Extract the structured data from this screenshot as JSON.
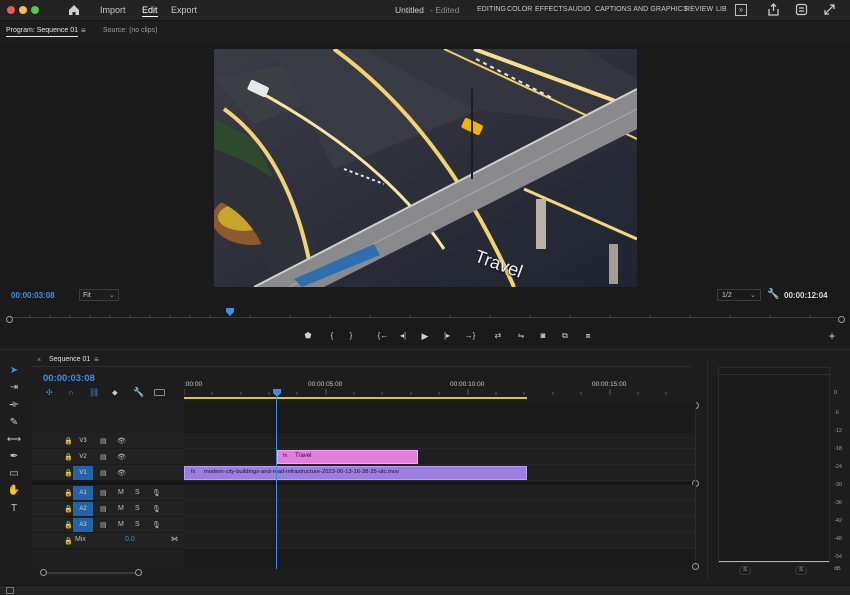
{
  "app": {
    "nav": {
      "import": "Import",
      "edit": "Edit",
      "export": "Export"
    },
    "project_title": "Untitled",
    "project_status": "- Edited",
    "workspaces": [
      "EDITING",
      "COLOR",
      "EFFECTS",
      "AUDIO",
      "CAPTIONS AND GRAPHICS",
      "REVIEW",
      "LIB"
    ],
    "colors": {
      "accent": "#3d8fe3",
      "close": "#ee5a51",
      "minimize": "#f5bd4f",
      "maximize": "#5fc453",
      "clip_video": "#9b7fe0",
      "clip_graphic": "#e37ee0",
      "workarea": "#d6c93a"
    }
  },
  "monitor": {
    "program_tab": "Program: Sequence 01",
    "source_tab": "Source: (no clips)",
    "video_text": "Travel",
    "timecode": "00:00:03:08",
    "fit": "Fit",
    "resolution": "1/2",
    "duration": "00:00:12:04"
  },
  "timeline": {
    "sequence_tab": "Sequence 01",
    "timecode": "00:00:03:08",
    "ruler": [
      ":00:00",
      "00:00:05:00",
      "00:00:10:00",
      "00:00:15:00"
    ],
    "tracks": {
      "v3": "V3",
      "v2": "V2",
      "v1_src": "V1",
      "v1": "V1",
      "a1_src": "A1",
      "a1": "A1",
      "a2_src": "A2",
      "a2": "A2",
      "a3_src": "A3",
      "a3": "A3",
      "mix": "Mix",
      "mix_value": "0.0"
    },
    "clips": {
      "title": "Travel",
      "video": "modern-city-buildings-and-road-infrastructure-2023-06-13-16-38-35-utc.mov"
    },
    "meter_labels": [
      "0",
      "-6",
      "-12",
      "-18",
      "-24",
      "-30",
      "-36",
      "-42",
      "-48",
      "-54",
      "dB"
    ],
    "meter_solo": "S"
  }
}
